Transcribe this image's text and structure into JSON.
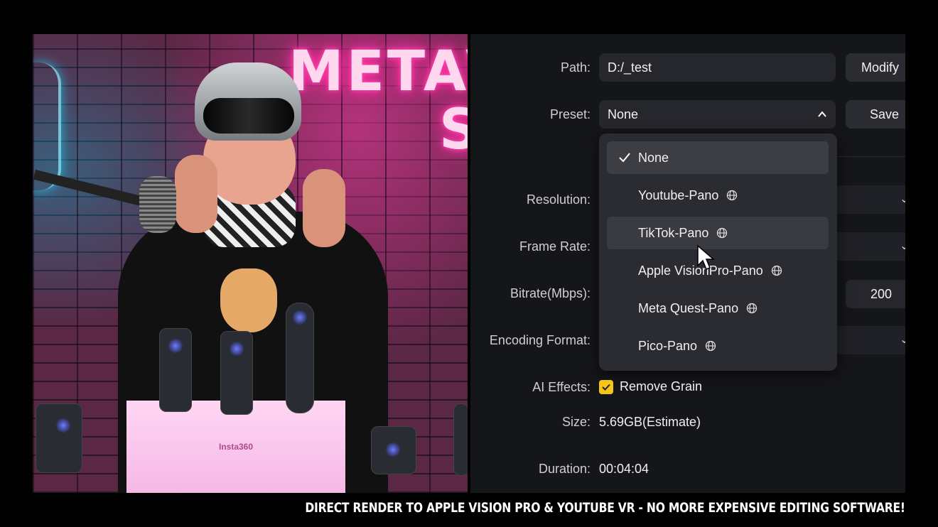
{
  "video": {
    "neon_sign_line1": "METAV",
    "neon_sign_line2": "S",
    "box_label": "Insta360"
  },
  "settings": {
    "path": {
      "label": "Path:",
      "value": "D:/_test",
      "button": "Modify"
    },
    "preset": {
      "label": "Preset:",
      "value": "None",
      "button": "Save",
      "expanded": true
    },
    "preset_options": [
      {
        "label": "None",
        "selected": true,
        "has_globe": false
      },
      {
        "label": "Youtube-Pano",
        "selected": false,
        "has_globe": true
      },
      {
        "label": "TikTok-Pano",
        "selected": false,
        "has_globe": true,
        "hovered": true
      },
      {
        "label": "Apple VisionPro-Pano",
        "selected": false,
        "has_globe": true
      },
      {
        "label": "Meta Quest-Pano",
        "selected": false,
        "has_globe": true
      },
      {
        "label": "Pico-Pano",
        "selected": false,
        "has_globe": true
      }
    ],
    "resolution": {
      "label": "Resolution:"
    },
    "frame_rate": {
      "label": "Frame Rate:"
    },
    "bitrate": {
      "label": "Bitrate(Mbps):",
      "value": "200"
    },
    "encoding_format": {
      "label": "Encoding Format:"
    },
    "ai_effects": {
      "label": "AI Effects:",
      "option": "Remove Grain",
      "checked": true
    },
    "size": {
      "label": "Size:",
      "value": "5.69GB(Estimate)"
    },
    "duration": {
      "label": "Duration:",
      "value": "00:04:04"
    }
  },
  "caption": "DIRECT RENDER TO APPLE VISION PRO & YOUTUBE VR - NO MORE EXPENSIVE EDITING SOFTWARE!",
  "colors": {
    "checkbox": "#f5c518",
    "panel_bg": "#15161a",
    "neon_pink": "#ff2ea0"
  }
}
